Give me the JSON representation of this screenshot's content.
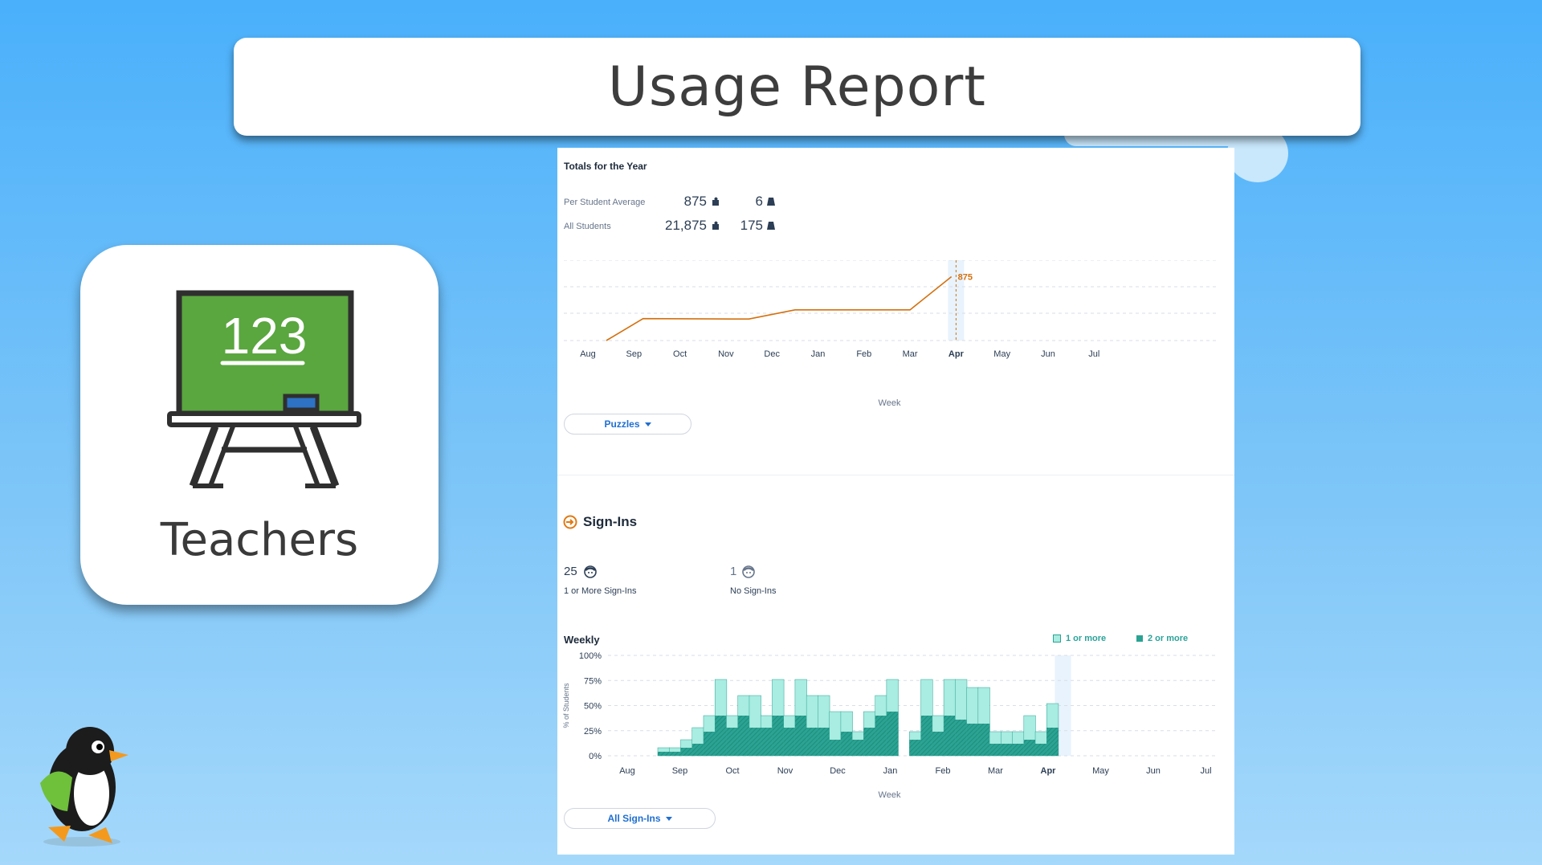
{
  "header": {
    "title": "Usage Report"
  },
  "teacher_card": {
    "label": "Teachers",
    "board_text": "123"
  },
  "totals": {
    "heading": "Totals for the Year",
    "rows": [
      {
        "label": "Per Student Average",
        "puzzles": "875",
        "levels": "6"
      },
      {
        "label": "All Students",
        "puzzles": "21,875",
        "levels": "175"
      }
    ]
  },
  "puzzles_chart": {
    "selector_label": "Puzzles",
    "xlabel": "Week",
    "highlight_value": "875",
    "months": [
      "Aug",
      "Sep",
      "Oct",
      "Nov",
      "Dec",
      "Jan",
      "Feb",
      "Mar",
      "Apr",
      "May",
      "Jun",
      "Jul"
    ],
    "current_month": "Apr"
  },
  "signins": {
    "heading": "Sign-Ins",
    "stats": [
      {
        "value": "25",
        "label": "1 or More Sign-Ins"
      },
      {
        "value": "1",
        "label": "No Sign-Ins"
      }
    ],
    "weekly_title": "Weekly",
    "legend": [
      "1 or more",
      "2 or more"
    ],
    "ylabel": "% of Students",
    "xlabel": "Week",
    "selector_label": "All Sign-Ins"
  },
  "colors": {
    "line": "#d4700f",
    "bar_light": "#a9ece1",
    "bar_dark": "#2aa393",
    "highlight": "#e8f3fd"
  },
  "chart_data": [
    {
      "type": "line",
      "title": "",
      "xlabel": "Week",
      "ylabel": "",
      "categories": [
        "Aug",
        "Sep",
        "Oct",
        "Nov",
        "Dec",
        "Jan",
        "Feb",
        "Mar",
        "Apr",
        "May",
        "Jun",
        "Jul"
      ],
      "x": [
        0.4,
        1.2,
        3.1,
        3.5,
        4.5,
        7.0,
        7.9
      ],
      "y": [
        0,
        300,
        295,
        295,
        420,
        420,
        875
      ],
      "ylim": [
        0,
        1100
      ],
      "annotations": [
        "875"
      ],
      "grid": true
    },
    {
      "type": "bar",
      "title": "Weekly",
      "xlabel": "Week",
      "ylabel": "% of Students",
      "yticks": [
        "0%",
        "25%",
        "50%",
        "75%",
        "100%"
      ],
      "ylim": [
        0,
        100
      ],
      "categories": [
        "Aug",
        "Sep",
        "Oct",
        "Nov",
        "Dec",
        "Jan",
        "Feb",
        "Mar",
        "Apr",
        "May",
        "Jun",
        "Jul"
      ],
      "legend_position": "top-right",
      "series": [
        {
          "name": "1 or more",
          "values": [
            8,
            8,
            16,
            28,
            40,
            76,
            40,
            60,
            60,
            40,
            76,
            40,
            76,
            60,
            60,
            44,
            44,
            24,
            44,
            60,
            76,
            0,
            24,
            76,
            40,
            76,
            76,
            68,
            68,
            24,
            24,
            24,
            40,
            24,
            52
          ]
        },
        {
          "name": "2 or more",
          "values": [
            4,
            4,
            8,
            12,
            24,
            40,
            28,
            40,
            28,
            28,
            40,
            28,
            40,
            28,
            28,
            16,
            24,
            16,
            28,
            40,
            44,
            0,
            16,
            40,
            24,
            40,
            36,
            32,
            32,
            12,
            12,
            12,
            16,
            12,
            28
          ]
        }
      ]
    }
  ]
}
